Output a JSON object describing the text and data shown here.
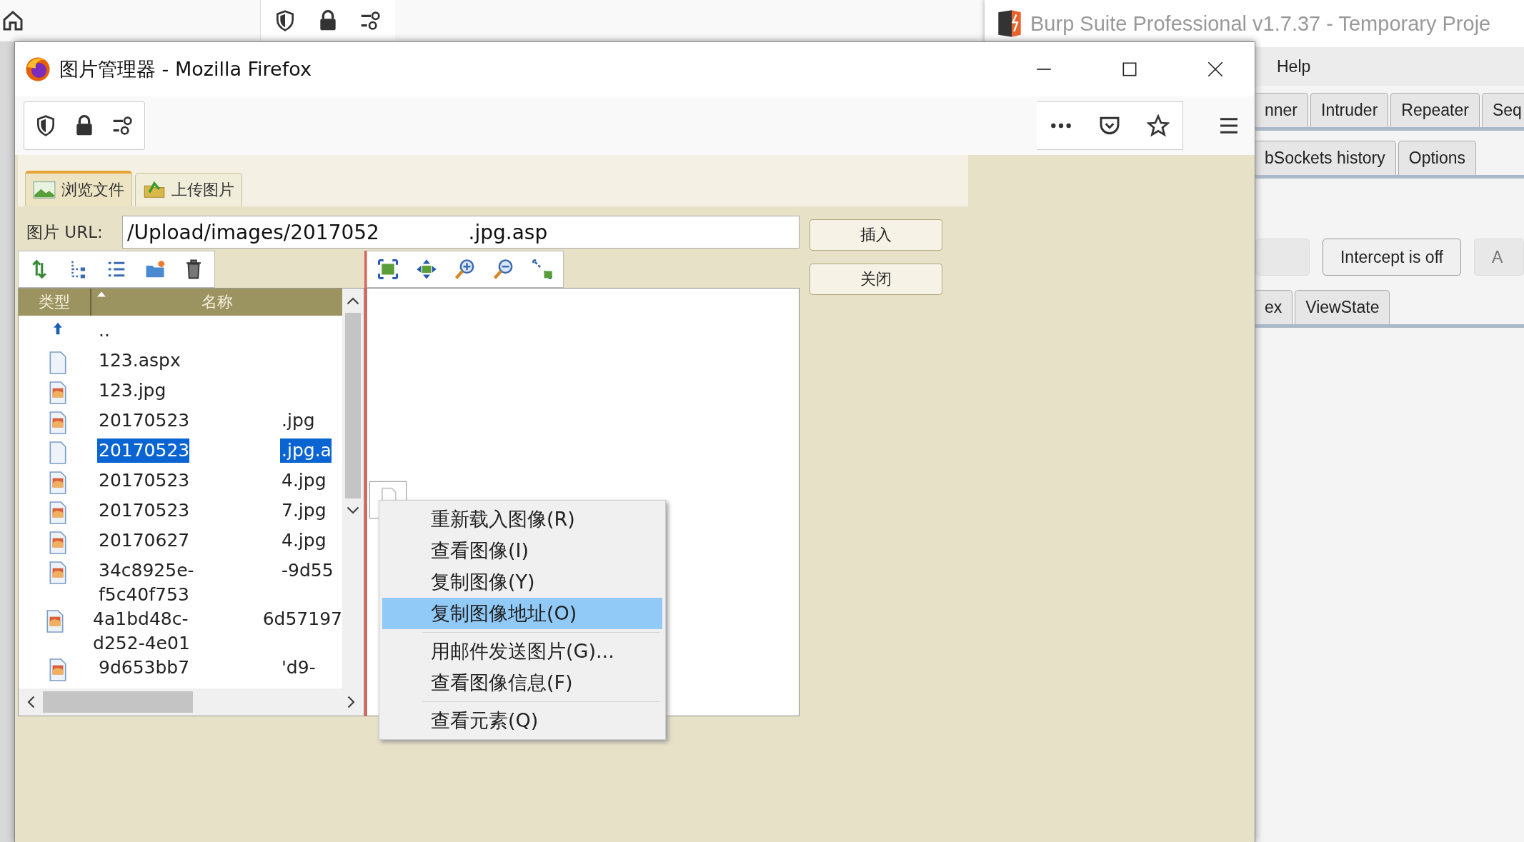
{
  "firefox_window": {
    "title": "图片管理器 - Mozilla Firefox"
  },
  "image_manager": {
    "tabs": [
      {
        "label": "浏览文件",
        "selected": true
      },
      {
        "label": "上传图片",
        "selected": false
      }
    ],
    "url_label": "图片 URL:",
    "url_value": "/Upload/images/2017052              .jpg.asp",
    "buttons": [
      "插入",
      "关闭"
    ],
    "file_list": {
      "columns": [
        "类型",
        "名称"
      ],
      "rows": [
        {
          "kind": "up",
          "name": [
            ".."
          ],
          "selected": false
        },
        {
          "kind": "document",
          "name": [
            "123.aspx"
          ],
          "selected": false
        },
        {
          "kind": "image",
          "name": [
            "123.jpg"
          ],
          "selected": false
        },
        {
          "kind": "image",
          "name": [
            "20170523"
          ],
          "name_end": ".jpg",
          "selected": false
        },
        {
          "kind": "document",
          "name": [
            "20170523"
          ],
          "name_end": ".jpg.a",
          "selected": true
        },
        {
          "kind": "image",
          "name": [
            "20170523"
          ],
          "name_end": "4.jpg",
          "selected": false
        },
        {
          "kind": "image",
          "name": [
            "20170523"
          ],
          "name_end": "7.jpg",
          "selected": false
        },
        {
          "kind": "image",
          "name": [
            "20170627"
          ],
          "name_end": "4.jpg",
          "selected": false
        },
        {
          "kind": "image",
          "name": [
            "34c8925e-",
            "f5c40f753"
          ],
          "name_end": "-9d55",
          "selected": false
        },
        {
          "kind": "image",
          "name": [
            "4a1bd48c-",
            "d252-4e01"
          ],
          "name_end": "6d57197",
          "selected": false
        },
        {
          "kind": "image",
          "name": [
            "9d653bb7"
          ],
          "name_end": "'d9-",
          "selected": false
        }
      ]
    }
  },
  "context_menu": {
    "items": [
      {
        "kind": "item",
        "label": "重新载入图像(R)",
        "selected": false
      },
      {
        "kind": "item",
        "label": "查看图像(I)",
        "selected": false
      },
      {
        "kind": "item",
        "label": "复制图像(Y)",
        "selected": false
      },
      {
        "kind": "item",
        "label": "复制图像地址(O)",
        "selected": true
      },
      {
        "kind": "separator"
      },
      {
        "kind": "item",
        "label": "用邮件发送图片(G)...",
        "selected": false
      },
      {
        "kind": "item",
        "label": "查看图像信息(F)",
        "selected": false
      },
      {
        "kind": "separator"
      },
      {
        "kind": "item",
        "label": "查看元素(Q)",
        "selected": false
      }
    ]
  },
  "burp_window": {
    "title": "Burp Suite Professional v1.7.37 - Temporary Proje",
    "menu": [
      "Help"
    ],
    "tabs": [
      "nner",
      "Intruder",
      "Repeater",
      "Seq"
    ],
    "subtabs": [
      "bSockets history",
      "Options"
    ],
    "buttons": [
      {
        "label": "Intercept is off",
        "disabled": false
      },
      {
        "label": "A",
        "disabled": true
      }
    ],
    "message_tabs": [
      "ex",
      "ViewState"
    ]
  }
}
